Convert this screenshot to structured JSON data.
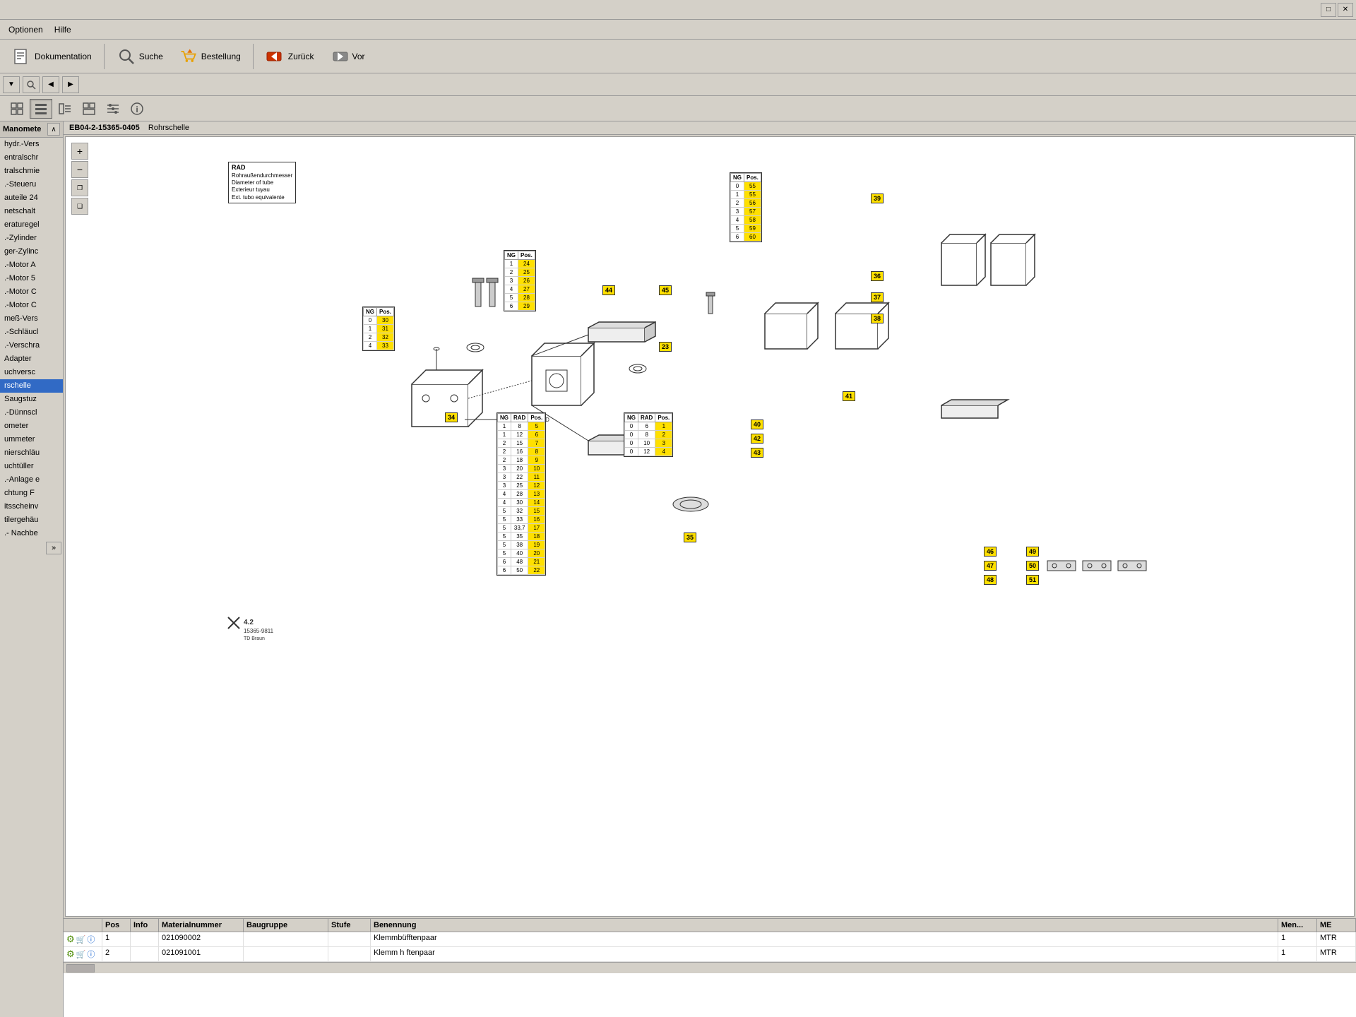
{
  "titlebar": {
    "buttons": [
      "restore",
      "close"
    ]
  },
  "menubar": {
    "items": [
      "Optionen",
      "Hilfe"
    ]
  },
  "toolbar": {
    "dokumentation_label": "Dokumentation",
    "suche_label": "Suche",
    "bestellung_label": "Bestellung",
    "zuruck_label": "Zurück",
    "vor_label": "Vor"
  },
  "breadcrumb": {
    "code": "EB04-2-15365-0405",
    "title": "Rohrschelle"
  },
  "sidebar": {
    "header": "Manomete",
    "items": [
      "hydr.-Vers",
      "entralschr",
      "tralschmie",
      ".-Steueru",
      "auteile 24",
      "netschalt",
      "eraturegel",
      ".-Zylinder",
      "ger-Zylinc",
      ".-Motor A",
      ".-Motor 5",
      ".-Motor C",
      ".-Motor C",
      "meß-Vers",
      ".-Schläucl",
      ".-Verschra",
      "Adapter",
      "uchversc",
      "rschelle",
      "Saugstuz",
      ".-Dünnscl",
      "ometer",
      "ummeter",
      "nierschläu",
      "uchtüller",
      ".-Anlage e",
      "chtung F",
      "itsscheinv",
      "tilergehäu",
      ".- Nachbe"
    ]
  },
  "diagram": {
    "label_box": {
      "title": "RAD",
      "lines": [
        "Rohraußendurchmesser",
        "Diameter of tube",
        "Exterieur tuyau",
        "Ext. tubo equivalente"
      ]
    },
    "tables": {
      "t1": {
        "headers": [
          "NG",
          "Pos."
        ],
        "rows": [
          [
            "0",
            "30"
          ],
          [
            "1",
            "31"
          ],
          [
            "2",
            "32"
          ],
          [
            "4",
            "33"
          ]
        ],
        "highlight_col": 1
      },
      "t2": {
        "headers": [
          "NG",
          "Pos."
        ],
        "rows": [
          [
            "1",
            "24"
          ],
          [
            "2",
            "25"
          ],
          [
            "3",
            "26"
          ],
          [
            "4",
            "27"
          ],
          [
            "5",
            "28"
          ],
          [
            "6",
            "29"
          ]
        ],
        "highlight_col": 1
      },
      "t3": {
        "headers": [
          "NG",
          "Pos."
        ],
        "rows": [
          [
            "0",
            "55"
          ],
          [
            "1",
            "55"
          ],
          [
            "2",
            "56"
          ],
          [
            "3",
            "57"
          ],
          [
            "4",
            "58"
          ],
          [
            "5",
            "59"
          ],
          [
            "6",
            "60"
          ]
        ],
        "highlight_col": 1
      },
      "t4": {
        "headers": [
          "NG",
          "RAD",
          "Pos."
        ],
        "rows": [
          [
            "1",
            "8",
            "5"
          ],
          [
            "1",
            "12",
            "6"
          ],
          [
            "2",
            "15",
            "7"
          ],
          [
            "2",
            "16",
            "8"
          ],
          [
            "2",
            "18",
            "9"
          ],
          [
            "3",
            "20",
            "10"
          ],
          [
            "3",
            "22",
            "11"
          ],
          [
            "3",
            "25",
            "12"
          ],
          [
            "4",
            "28",
            "13"
          ],
          [
            "4",
            "30",
            "14"
          ],
          [
            "5",
            "32",
            "15"
          ],
          [
            "5",
            "33",
            "16"
          ],
          [
            "5",
            "33,7",
            "17"
          ],
          [
            "5",
            "35",
            "18"
          ],
          [
            "5",
            "38",
            "19"
          ],
          [
            "5",
            "40",
            "20"
          ],
          [
            "6",
            "48",
            "21"
          ],
          [
            "6",
            "50",
            "22"
          ]
        ],
        "highlight_col": 2
      },
      "t5": {
        "headers": [
          "NG",
          "RAD",
          "Pos."
        ],
        "rows": [
          [
            "0",
            "6",
            "1"
          ],
          [
            "0",
            "8",
            "2"
          ],
          [
            "0",
            "10",
            "3"
          ],
          [
            "0",
            "12",
            "4"
          ]
        ],
        "highlight_col": 2
      }
    },
    "badges": [
      "34",
      "23",
      "44",
      "45",
      "39",
      "36",
      "37",
      "38",
      "40",
      "42",
      "43",
      "41",
      "35",
      "46",
      "47",
      "48",
      "49",
      "50",
      "51"
    ],
    "stamp": "15365-9811",
    "stamp_label": "TD Braun",
    "version": "4.2"
  },
  "bottom_table": {
    "columns": [
      "",
      "Pos",
      "Info",
      "Materialnummer",
      "Baugruppe",
      "Stufe",
      "Benennung",
      "Men...",
      "ME"
    ],
    "rows": [
      {
        "pos": "1",
        "material": "021090002",
        "baugruppe": "",
        "stufe": "",
        "benennung": "Klemmbüfftenpaar",
        "menge": "1",
        "me": "MTR"
      },
      {
        "pos": "2",
        "material": "021091001",
        "baugruppe": "",
        "stufe": "",
        "benennung": "Klemm h ftenpaar",
        "menge": "1",
        "me": "MTR"
      }
    ]
  },
  "viewbtns": {
    "icons": [
      "grid-view",
      "list-view",
      "detail-view",
      "group-view",
      "filter-view",
      "info-view"
    ]
  }
}
